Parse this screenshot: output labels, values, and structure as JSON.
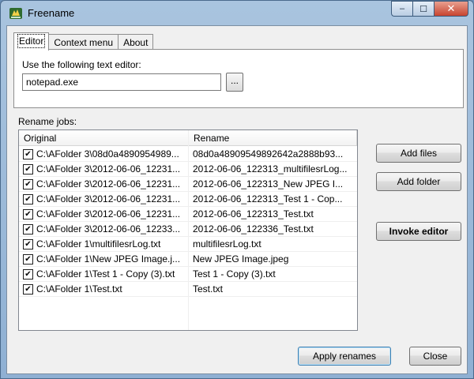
{
  "window": {
    "title": "Freename"
  },
  "caption_buttons": {
    "minimize": "–",
    "maximize": "☐",
    "close": "✕"
  },
  "tabs": [
    {
      "label": "Editor",
      "active": true
    },
    {
      "label": "Context menu",
      "active": false
    },
    {
      "label": "About",
      "active": false
    }
  ],
  "editor": {
    "label": "Use the following text editor:",
    "value": "notepad.exe",
    "browse_label": "..."
  },
  "rename_jobs": {
    "label": "Rename jobs:",
    "columns": [
      "Original",
      "Rename"
    ],
    "rows": [
      {
        "checked": true,
        "original": "C:\\AFolder 3\\08d0a4890954989...",
        "rename": "08d0a48909549892642a2888b93..."
      },
      {
        "checked": true,
        "original": "C:\\AFolder 3\\2012-06-06_12231...",
        "rename": "2012-06-06_122313_multifilesrLog..."
      },
      {
        "checked": true,
        "original": "C:\\AFolder 3\\2012-06-06_12231...",
        "rename": "2012-06-06_122313_New JPEG I..."
      },
      {
        "checked": true,
        "original": "C:\\AFolder 3\\2012-06-06_12231...",
        "rename": "2012-06-06_122313_Test 1 - Cop..."
      },
      {
        "checked": true,
        "original": "C:\\AFolder 3\\2012-06-06_12231...",
        "rename": "2012-06-06_122313_Test.txt"
      },
      {
        "checked": true,
        "original": "C:\\AFolder 3\\2012-06-06_12233...",
        "rename": "2012-06-06_122336_Test.txt"
      },
      {
        "checked": true,
        "original": "C:\\AFolder 1\\multifilesrLog.txt",
        "rename": "multifilesrLog.txt"
      },
      {
        "checked": true,
        "original": "C:\\AFolder 1\\New JPEG Image.j...",
        "rename": "New JPEG Image.jpeg"
      },
      {
        "checked": true,
        "original": "C:\\AFolder 1\\Test 1 - Copy (3).txt",
        "rename": "Test 1 - Copy (3).txt"
      },
      {
        "checked": true,
        "original": "C:\\AFolder 1\\Test.txt",
        "rename": "Test.txt"
      }
    ]
  },
  "buttons": {
    "add_files": "Add files",
    "add_folder": "Add folder",
    "invoke_editor": "Invoke editor",
    "apply_renames": "Apply renames",
    "close": "Close"
  },
  "check_glyph": "✔"
}
